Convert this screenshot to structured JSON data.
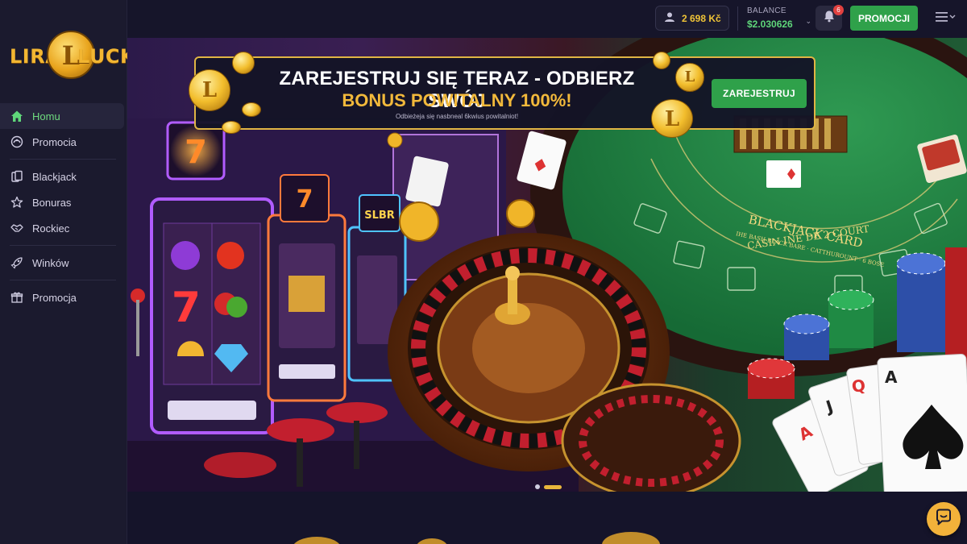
{
  "brand": {
    "left": "LIRA",
    "mark": "L",
    "right": "LUCK",
    "color": "#f2b632"
  },
  "sidebar": {
    "items": [
      {
        "label": "Homu",
        "icon": "home-icon",
        "active": true
      },
      {
        "label": "Promocia",
        "icon": "gift-icon"
      },
      {
        "label": "Blackjack",
        "icon": "cards-icon"
      },
      {
        "label": "Bonuras",
        "icon": "star-icon"
      },
      {
        "label": "Rockiec",
        "icon": "handshake-icon"
      },
      {
        "label": "Winków",
        "icon": "rocket-icon"
      },
      {
        "label": "Promocja",
        "icon": "gift-box-icon"
      }
    ]
  },
  "topbar": {
    "user_balance": "2 698 Kč",
    "balance_label": "BALANCE",
    "balance_value": "$2.030626",
    "notifications": "6",
    "promo_label": "PROMOCJI"
  },
  "banner": {
    "line1": "ZAREJESTRUJ SIĘ TERAZ - ODBIERZ SWÓJ",
    "line2": "BONUS POWITALNY 100%!",
    "small": "Odbieżeja się nasbneal 6kwius powitalniot!",
    "button": "ZAREJESTRUJ",
    "coin_mark": "L"
  },
  "hero": {
    "slot_symbol": "7",
    "slot_label": "SLBR",
    "table_text_1": "BLACKJACK CARD",
    "table_text_2": "CASIN INE DE 2 COURT",
    "table_text_small": "IHE BASH BLACK BARE · CATTHUROUNT · 6 BOSE",
    "card_a": "A",
    "card_q": "Q",
    "card_j": "J"
  },
  "carousel": {
    "slides": 2,
    "active": 1
  },
  "colors": {
    "accent_green": "#2fa14a",
    "gold": "#f2b93b",
    "background": "#16152a"
  }
}
